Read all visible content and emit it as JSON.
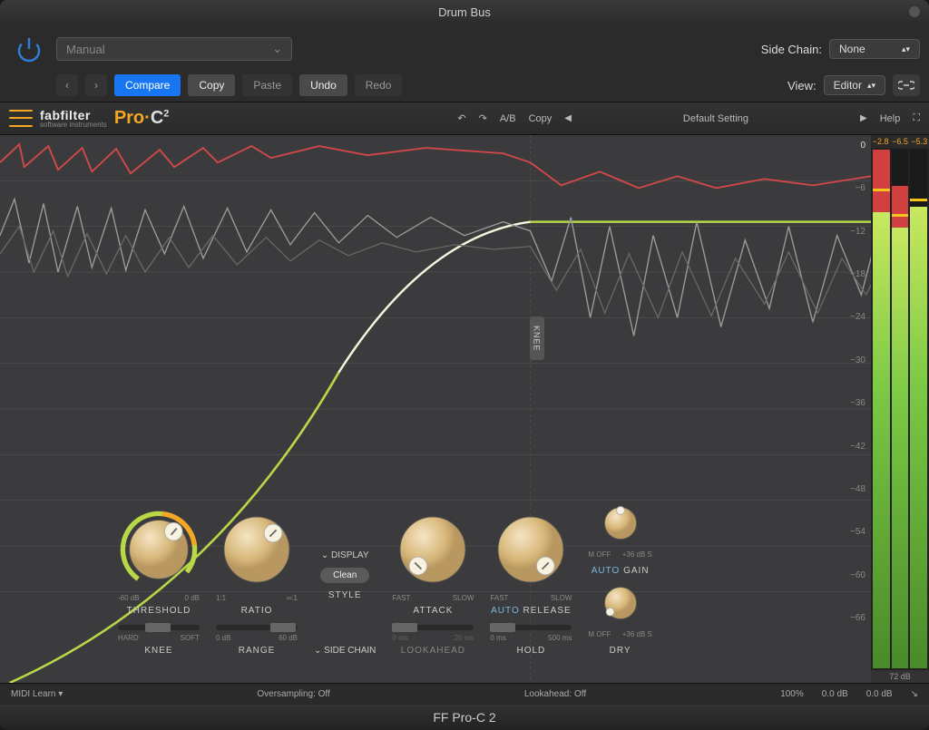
{
  "window": {
    "title": "Drum Bus"
  },
  "host": {
    "preset": "Manual",
    "sidechain_label": "Side Chain:",
    "sidechain_value": "None",
    "view_label": "View:",
    "view_value": "Editor",
    "buttons": {
      "compare": "Compare",
      "copy": "Copy",
      "paste": "Paste",
      "undo": "Undo",
      "redo": "Redo"
    }
  },
  "plugin": {
    "brand": "fabfilter",
    "brand_sub": "software instruments",
    "product_prefix": "Pro·",
    "product_suffix": "C",
    "product_sup": "2",
    "ab": "A/B",
    "copy": "Copy",
    "preset": "Default Setting",
    "help": "Help"
  },
  "scale": [
    "0",
    "−6",
    "−12",
    "−18",
    "−24",
    "−30",
    "−36",
    "−42",
    "−48",
    "−54",
    "−60",
    "−66"
  ],
  "meters": {
    "readouts": [
      "−2.8",
      "−6.5",
      "−5.3"
    ],
    "range": "72 dB"
  },
  "knee_tab": "KNEE",
  "controls": {
    "display": "DISPLAY",
    "sidechain": "SIDE CHAIN",
    "threshold": {
      "label": "THRESHOLD",
      "min": "-60 dB",
      "max": "0 dB"
    },
    "ratio": {
      "label": "RATIO",
      "min": "1:1",
      "max": "∞:1"
    },
    "style": {
      "label": "STYLE",
      "value": "Clean"
    },
    "attack": {
      "label": "ATTACK",
      "min": "FAST",
      "max": "SLOW"
    },
    "release": {
      "label": "RELEASE",
      "prefix": "AUTO",
      "min": "FAST",
      "max": "SLOW"
    },
    "gain": {
      "label": "GAIN",
      "prefix": "AUTO",
      "left": "M OFF",
      "right": "+36 dB S"
    },
    "dry": {
      "label": "DRY",
      "left": "M OFF",
      "right": "+36 dB S"
    },
    "knee": {
      "label": "KNEE",
      "min": "HARD",
      "max": "SOFT"
    },
    "range": {
      "label": "RANGE",
      "min": "0 dB",
      "max": "60 dB"
    },
    "lookahead": {
      "label": "LOOKAHEAD",
      "min": "0 ms",
      "max": "20 ms"
    },
    "hold": {
      "label": "HOLD",
      "min": "0 ms",
      "max": "500 ms"
    }
  },
  "status": {
    "midi": "MIDI Learn",
    "oversampling_label": "Oversampling:",
    "oversampling_value": "Off",
    "lookahead_label": "Lookahead:",
    "lookahead_value": "Off",
    "zoom": "100%",
    "out1": "0.0 dB",
    "out2": "0.0 dB"
  },
  "footer": "FF Pro-C 2"
}
